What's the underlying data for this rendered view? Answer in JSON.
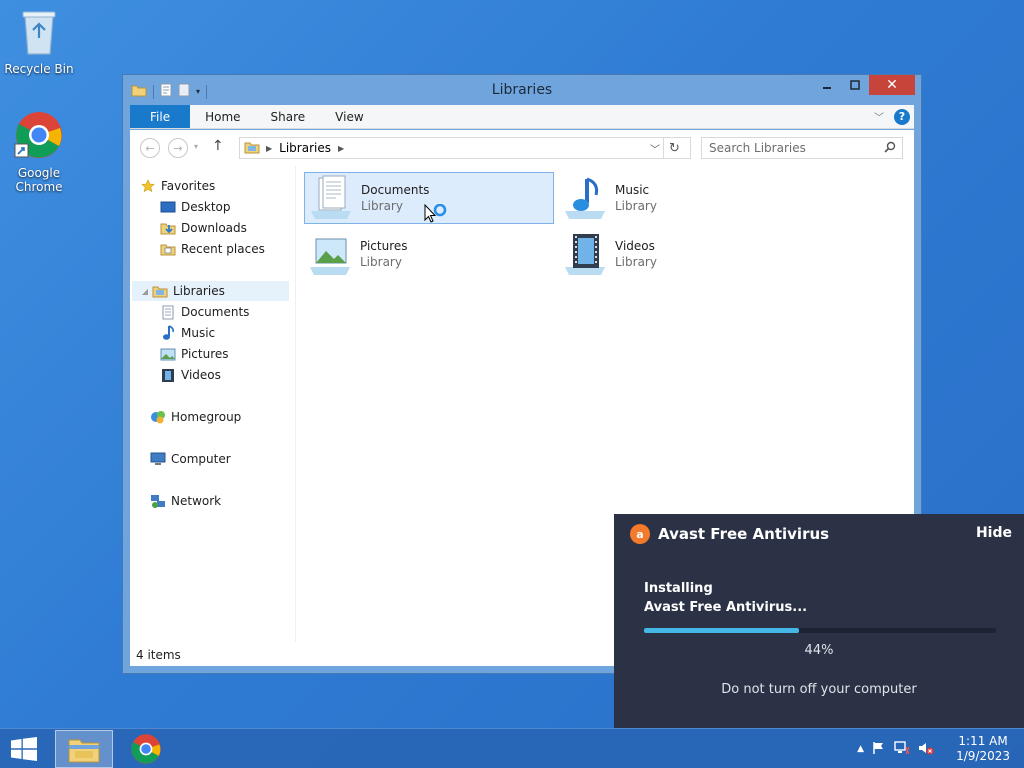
{
  "desktop": {
    "icons": [
      {
        "label": "Recycle Bin"
      },
      {
        "label": "Google Chrome"
      }
    ]
  },
  "window": {
    "title": "Libraries",
    "ribbon_tabs": [
      "File",
      "Home",
      "Share",
      "View"
    ],
    "address": {
      "crumb": "Libraries"
    },
    "search": {
      "placeholder": "Search Libraries"
    },
    "nav": {
      "favorites": "Favorites",
      "desktop": "Desktop",
      "downloads": "Downloads",
      "recent": "Recent places",
      "libraries": "Libraries",
      "documents": "Documents",
      "music": "Music",
      "pictures": "Pictures",
      "videos": "Videos",
      "homegroup": "Homegroup",
      "computer": "Computer",
      "network": "Network"
    },
    "tiles": [
      {
        "name": "Documents",
        "type": "Library"
      },
      {
        "name": "Music",
        "type": "Library"
      },
      {
        "name": "Pictures",
        "type": "Library"
      },
      {
        "name": "Videos",
        "type": "Library"
      }
    ],
    "status": "4 items"
  },
  "avast": {
    "title": "Avast Free Antivirus",
    "hide": "Hide",
    "line1": "Installing",
    "line2": "Avast Free Antivirus...",
    "progress": 44,
    "progress_label": "44%",
    "note": "Do not turn off your computer",
    "accent": "#45b7e6",
    "brand": "#f27a2a"
  },
  "taskbar": {
    "time": "1:11 AM",
    "date": "1/9/2023"
  }
}
